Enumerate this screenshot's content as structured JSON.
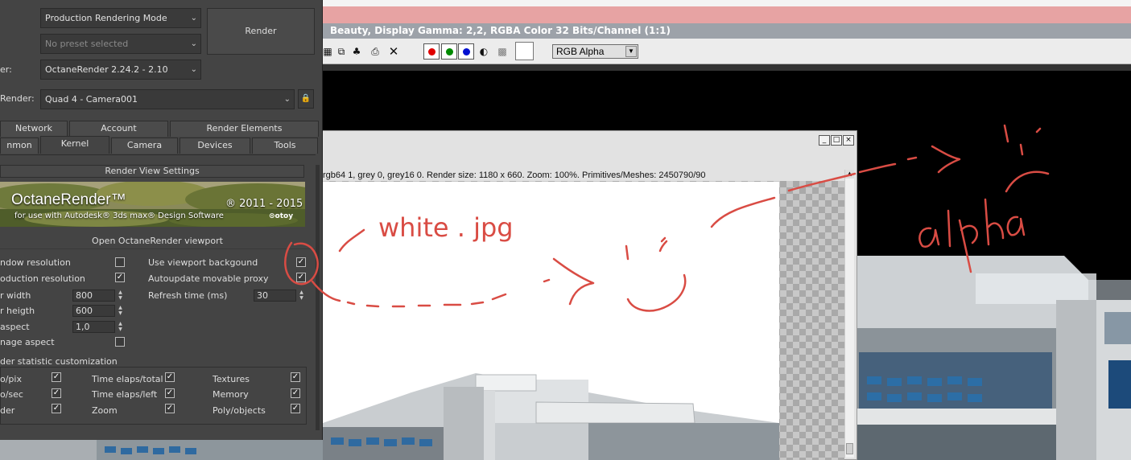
{
  "frame_buffer": {
    "title": "Beauty, Display Gamma: 2,2, RGBA Color 32 Bits/Channel (1:1)",
    "toolbar": {
      "icons": [
        "copy-icon",
        "clone-icon",
        "multi-icon",
        "print-icon",
        "clear-icon"
      ],
      "channel_buttons": [
        {
          "name": "red-channel",
          "color": "#e00000"
        },
        {
          "name": "green-channel",
          "color": "#008a00"
        },
        {
          "name": "blue-channel",
          "color": "#0010d0"
        }
      ],
      "channel_select": "RGB Alpha"
    }
  },
  "render_window": {
    "info_line": "rgb64 1, grey 0, grey16 0.   Render size: 1180 x 660.   Zoom: 100%.   Primitives/Meshes: 2450790/90",
    "buttons": [
      "_",
      "□",
      "×"
    ]
  },
  "render_setup": {
    "mode_select": "Production Rendering Mode",
    "preset_select": "No preset selected",
    "render_button": "Render",
    "renderer_label": "er:",
    "renderer_select": "OctaneRender 2.24.2 - 2.10",
    "view_label": "Render:",
    "view_select": "Quad 4 - Camera001",
    "tabs_row1": [
      "Network",
      "Account",
      "Render Elements"
    ],
    "tabs_row2": [
      "nmon",
      "Kernel",
      "Camera",
      "Devices",
      "Tools"
    ],
    "active_tab": "Kernel",
    "section_title": "Render View Settings",
    "banner": {
      "title": "OctaneRender™",
      "subtitle": "for use with Autodesk® 3ds max® Design Software",
      "years": "® 2011 - 2015",
      "logo": "⊙otoy"
    },
    "open_viewport_button": "Open OctaneRender viewport",
    "rows": {
      "window_resolution": {
        "label": "ndow resolution",
        "checked": false
      },
      "production_resolution": {
        "label": "oduction resolution",
        "checked": true
      },
      "width": {
        "label": "r width",
        "value": "800"
      },
      "height": {
        "label": "r heigth",
        "value": "600"
      },
      "aspect": {
        "label": "aspect",
        "value": "1,0"
      },
      "image_aspect": {
        "label": "nage aspect",
        "checked": false
      },
      "use_viewport_bg": {
        "label": "Use viewport backgound",
        "checked": true
      },
      "autoupdate_proxy": {
        "label": "Autoupdate movable proxy",
        "checked": true
      },
      "refresh_time": {
        "label": "Refresh time (ms)",
        "value": "30"
      }
    },
    "stat_group": {
      "title": "der statistic customization",
      "items": [
        {
          "label": "o/pix",
          "checked": true
        },
        {
          "label": "Time elaps/total",
          "checked": true
        },
        {
          "label": "Textures",
          "checked": true
        },
        {
          "label": "o/sec",
          "checked": true
        },
        {
          "label": "Time elaps/left",
          "checked": true
        },
        {
          "label": "Memory",
          "checked": true
        },
        {
          "label": "der",
          "checked": true
        },
        {
          "label": "Zoom",
          "checked": true
        },
        {
          "label": "Poly/objects",
          "checked": true
        }
      ]
    }
  },
  "annotations": {
    "white_label": "white . jpg",
    "alpha_label": "alpha",
    "color": "#d94c44"
  }
}
